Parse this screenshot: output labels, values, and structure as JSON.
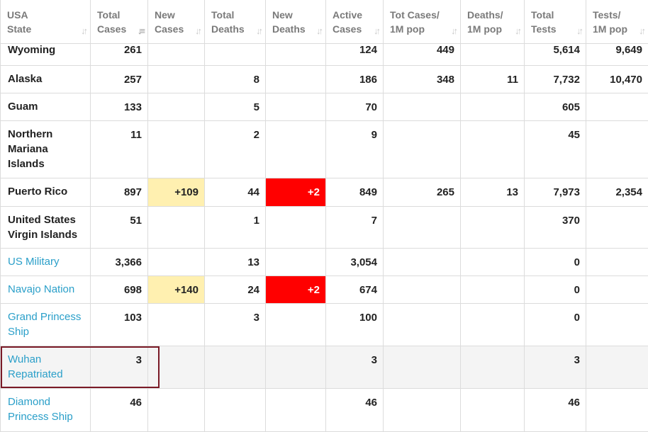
{
  "headers": [
    {
      "line1": "USA",
      "line2": "State",
      "sort_active": false
    },
    {
      "line1": "Total",
      "line2": "Cases",
      "sort_active": true
    },
    {
      "line1": "New",
      "line2": "Cases",
      "sort_active": false
    },
    {
      "line1": "Total",
      "line2": "Deaths",
      "sort_active": false
    },
    {
      "line1": "New",
      "line2": "Deaths",
      "sort_active": false
    },
    {
      "line1": "Active",
      "line2": "Cases",
      "sort_active": false
    },
    {
      "line1": "Tot Cases/",
      "line2": "1M pop",
      "sort_active": false
    },
    {
      "line1": "Deaths/",
      "line2": "1M pop",
      "sort_active": false
    },
    {
      "line1": "Total",
      "line2": "Tests",
      "sort_active": false
    },
    {
      "line1": "Tests/",
      "line2": "1M pop",
      "sort_active": false
    }
  ],
  "sort_icon": "sort-arrows-icon",
  "colors": {
    "link": "#2a9fc9",
    "new_cases_highlight": "#fff0b0",
    "new_deaths_highlight": "#ff0000",
    "selection_border": "#7a1a26"
  },
  "rows": [
    {
      "state": "Wyoming",
      "link": false,
      "total_cases": "261",
      "new_cases": "",
      "total_deaths": "",
      "new_deaths": "",
      "active_cases": "124",
      "tot_cases_1m": "449",
      "deaths_1m": "",
      "total_tests": "5,614",
      "tests_1m": "9,649"
    },
    {
      "state": "Alaska",
      "link": false,
      "total_cases": "257",
      "new_cases": "",
      "total_deaths": "8",
      "new_deaths": "",
      "active_cases": "186",
      "tot_cases_1m": "348",
      "deaths_1m": "11",
      "total_tests": "7,732",
      "tests_1m": "10,470"
    },
    {
      "state": "Guam",
      "link": false,
      "total_cases": "133",
      "new_cases": "",
      "total_deaths": "5",
      "new_deaths": "",
      "active_cases": "70",
      "tot_cases_1m": "",
      "deaths_1m": "",
      "total_tests": "605",
      "tests_1m": ""
    },
    {
      "state": "Northern Mariana Islands",
      "link": false,
      "total_cases": "11",
      "new_cases": "",
      "total_deaths": "2",
      "new_deaths": "",
      "active_cases": "9",
      "tot_cases_1m": "",
      "deaths_1m": "",
      "total_tests": "45",
      "tests_1m": ""
    },
    {
      "state": "Puerto Rico",
      "link": false,
      "total_cases": "897",
      "new_cases": "+109",
      "total_deaths": "44",
      "new_deaths": "+2",
      "active_cases": "849",
      "tot_cases_1m": "265",
      "deaths_1m": "13",
      "total_tests": "7,973",
      "tests_1m": "2,354"
    },
    {
      "state": "United States Virgin Islands",
      "link": false,
      "total_cases": "51",
      "new_cases": "",
      "total_deaths": "1",
      "new_deaths": "",
      "active_cases": "7",
      "tot_cases_1m": "",
      "deaths_1m": "",
      "total_tests": "370",
      "tests_1m": ""
    },
    {
      "state": "US Military",
      "link": true,
      "total_cases": "3,366",
      "new_cases": "",
      "total_deaths": "13",
      "new_deaths": "",
      "active_cases": "3,054",
      "tot_cases_1m": "",
      "deaths_1m": "",
      "total_tests": "0",
      "tests_1m": ""
    },
    {
      "state": "Navajo Nation",
      "link": true,
      "total_cases": "698",
      "new_cases": "+140",
      "total_deaths": "24",
      "new_deaths": "+2",
      "active_cases": "674",
      "tot_cases_1m": "",
      "deaths_1m": "",
      "total_tests": "0",
      "tests_1m": ""
    },
    {
      "state": "Grand Princess Ship",
      "link": true,
      "total_cases": "103",
      "new_cases": "",
      "total_deaths": "3",
      "new_deaths": "",
      "active_cases": "100",
      "tot_cases_1m": "",
      "deaths_1m": "",
      "total_tests": "0",
      "tests_1m": ""
    },
    {
      "state": "Wuhan Repatriated",
      "link": true,
      "total_cases": "3",
      "new_cases": "",
      "total_deaths": "",
      "new_deaths": "",
      "active_cases": "3",
      "tot_cases_1m": "",
      "deaths_1m": "",
      "total_tests": "3",
      "tests_1m": "",
      "highlighted": true
    },
    {
      "state": "Diamond Princess Ship",
      "link": true,
      "total_cases": "46",
      "new_cases": "",
      "total_deaths": "",
      "new_deaths": "",
      "active_cases": "46",
      "tot_cases_1m": "",
      "deaths_1m": "",
      "total_tests": "46",
      "tests_1m": ""
    }
  ]
}
